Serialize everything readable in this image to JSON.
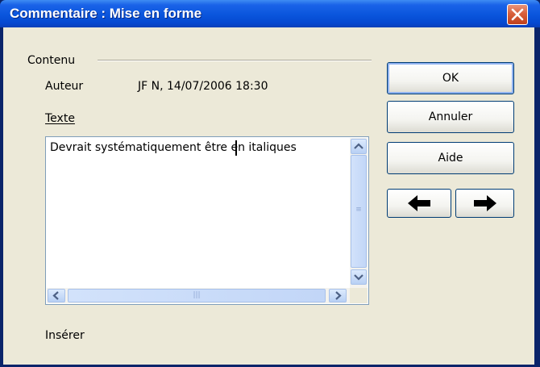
{
  "window": {
    "title": "Commentaire : Mise en forme",
    "close_icon": "close-icon"
  },
  "content": {
    "section_label": "Contenu",
    "author_label": "Auteur",
    "author_value": "JF N, 14/07/2006 18:30",
    "text_label": "Texte",
    "text_value": "Devrait systématiquement être en italiques",
    "insert_label": "Insérer"
  },
  "buttons": {
    "ok": "OK",
    "cancel": "Annuler",
    "help": "Aide",
    "prev": "🡄",
    "next": "🡆"
  },
  "icons": {
    "prev": "arrow-left-icon",
    "next": "arrow-right-icon"
  },
  "colors": {
    "titlebar": "#0a55dc",
    "face": "#ece9d8",
    "border": "#0a246a"
  }
}
